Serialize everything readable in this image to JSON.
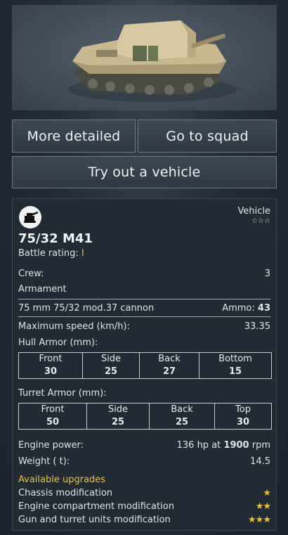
{
  "buttons": {
    "more_detailed": "More detailed",
    "go_to_squad": "Go to squad",
    "try_vehicle": "Try out a vehicle"
  },
  "vehicle": {
    "type": "Vehicle",
    "type_stars": "☆☆☆",
    "name": "75/32 M41",
    "battle_rating_label": "Battle rating:",
    "battle_rating": "I",
    "crew_label": "Crew:",
    "crew": "3",
    "armament_label": "Armament",
    "cannon": "75 mm 75/32 mod.37 cannon",
    "ammo_label": "Ammo:",
    "ammo": "43",
    "speed_label": "Maximum speed (km/h):",
    "speed": "33.35",
    "hull_label": "Hull Armor (mm):",
    "hull": [
      {
        "name": "Front",
        "value": "30"
      },
      {
        "name": "Side",
        "value": "25"
      },
      {
        "name": "Back",
        "value": "27"
      },
      {
        "name": "Bottom",
        "value": "15"
      }
    ],
    "turret_label": "Turret Armor (mm):",
    "turret": [
      {
        "name": "Front",
        "value": "50"
      },
      {
        "name": "Side",
        "value": "25"
      },
      {
        "name": "Back",
        "value": "25"
      },
      {
        "name": "Top",
        "value": "30"
      }
    ],
    "engine_label": "Engine power:",
    "engine_hp": "136 hp at",
    "engine_rpm": "1900",
    "engine_rpm_unit": "rpm",
    "weight_label": "Weight ( t):",
    "weight": "14.5",
    "upgrades_title": "Available upgrades",
    "upgrades": [
      {
        "name": "Chassis modification",
        "stars": "★"
      },
      {
        "name": "Engine compartment modification",
        "stars": "★★"
      },
      {
        "name": "Gun and turret units modification",
        "stars": "★★★"
      }
    ]
  },
  "colors": {
    "accent": "#f0c02b",
    "panel": "#222b34",
    "button": "#36414c"
  }
}
